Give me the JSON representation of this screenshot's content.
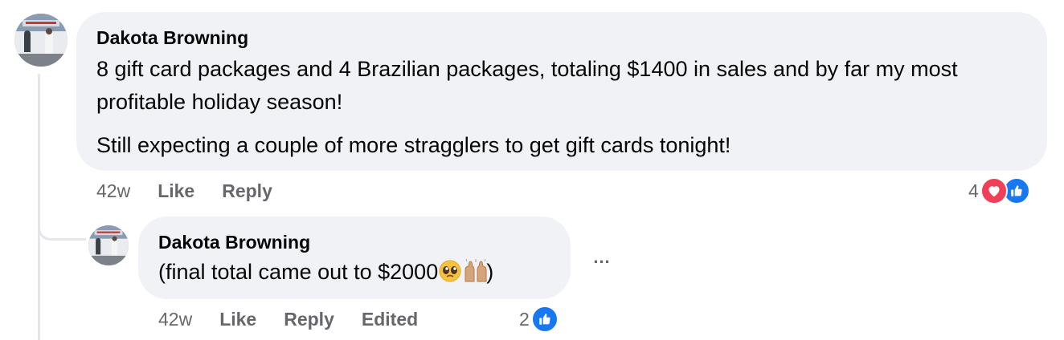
{
  "comment": {
    "author": "Dakota Browning",
    "paragraphs": [
      "8 gift card packages and 4 Brazilian packages, totaling $1400 in sales and by far my most profitable holiday season!",
      "Still expecting a couple of more stragglers to get gift cards tonight!"
    ],
    "time": "42w",
    "like_label": "Like",
    "reply_label": "Reply",
    "reaction_count": "4",
    "reactions": [
      "heart-icon",
      "like-icon"
    ]
  },
  "reply": {
    "author": "Dakota Browning",
    "text": "(final total came out to $2000",
    "text_end": ")",
    "emojis": [
      "pleading-face-icon",
      "raising-hands-icon"
    ],
    "time": "42w",
    "like_label": "Like",
    "reply_label": "Reply",
    "edited_label": "Edited",
    "reaction_count": "2",
    "reactions": [
      "like-icon"
    ],
    "more_label": "..."
  },
  "colors": {
    "bubble": "#f0f2f5",
    "meta_text": "#65676b",
    "like_blue": "#1877f2",
    "love_red": "#f33e58"
  }
}
